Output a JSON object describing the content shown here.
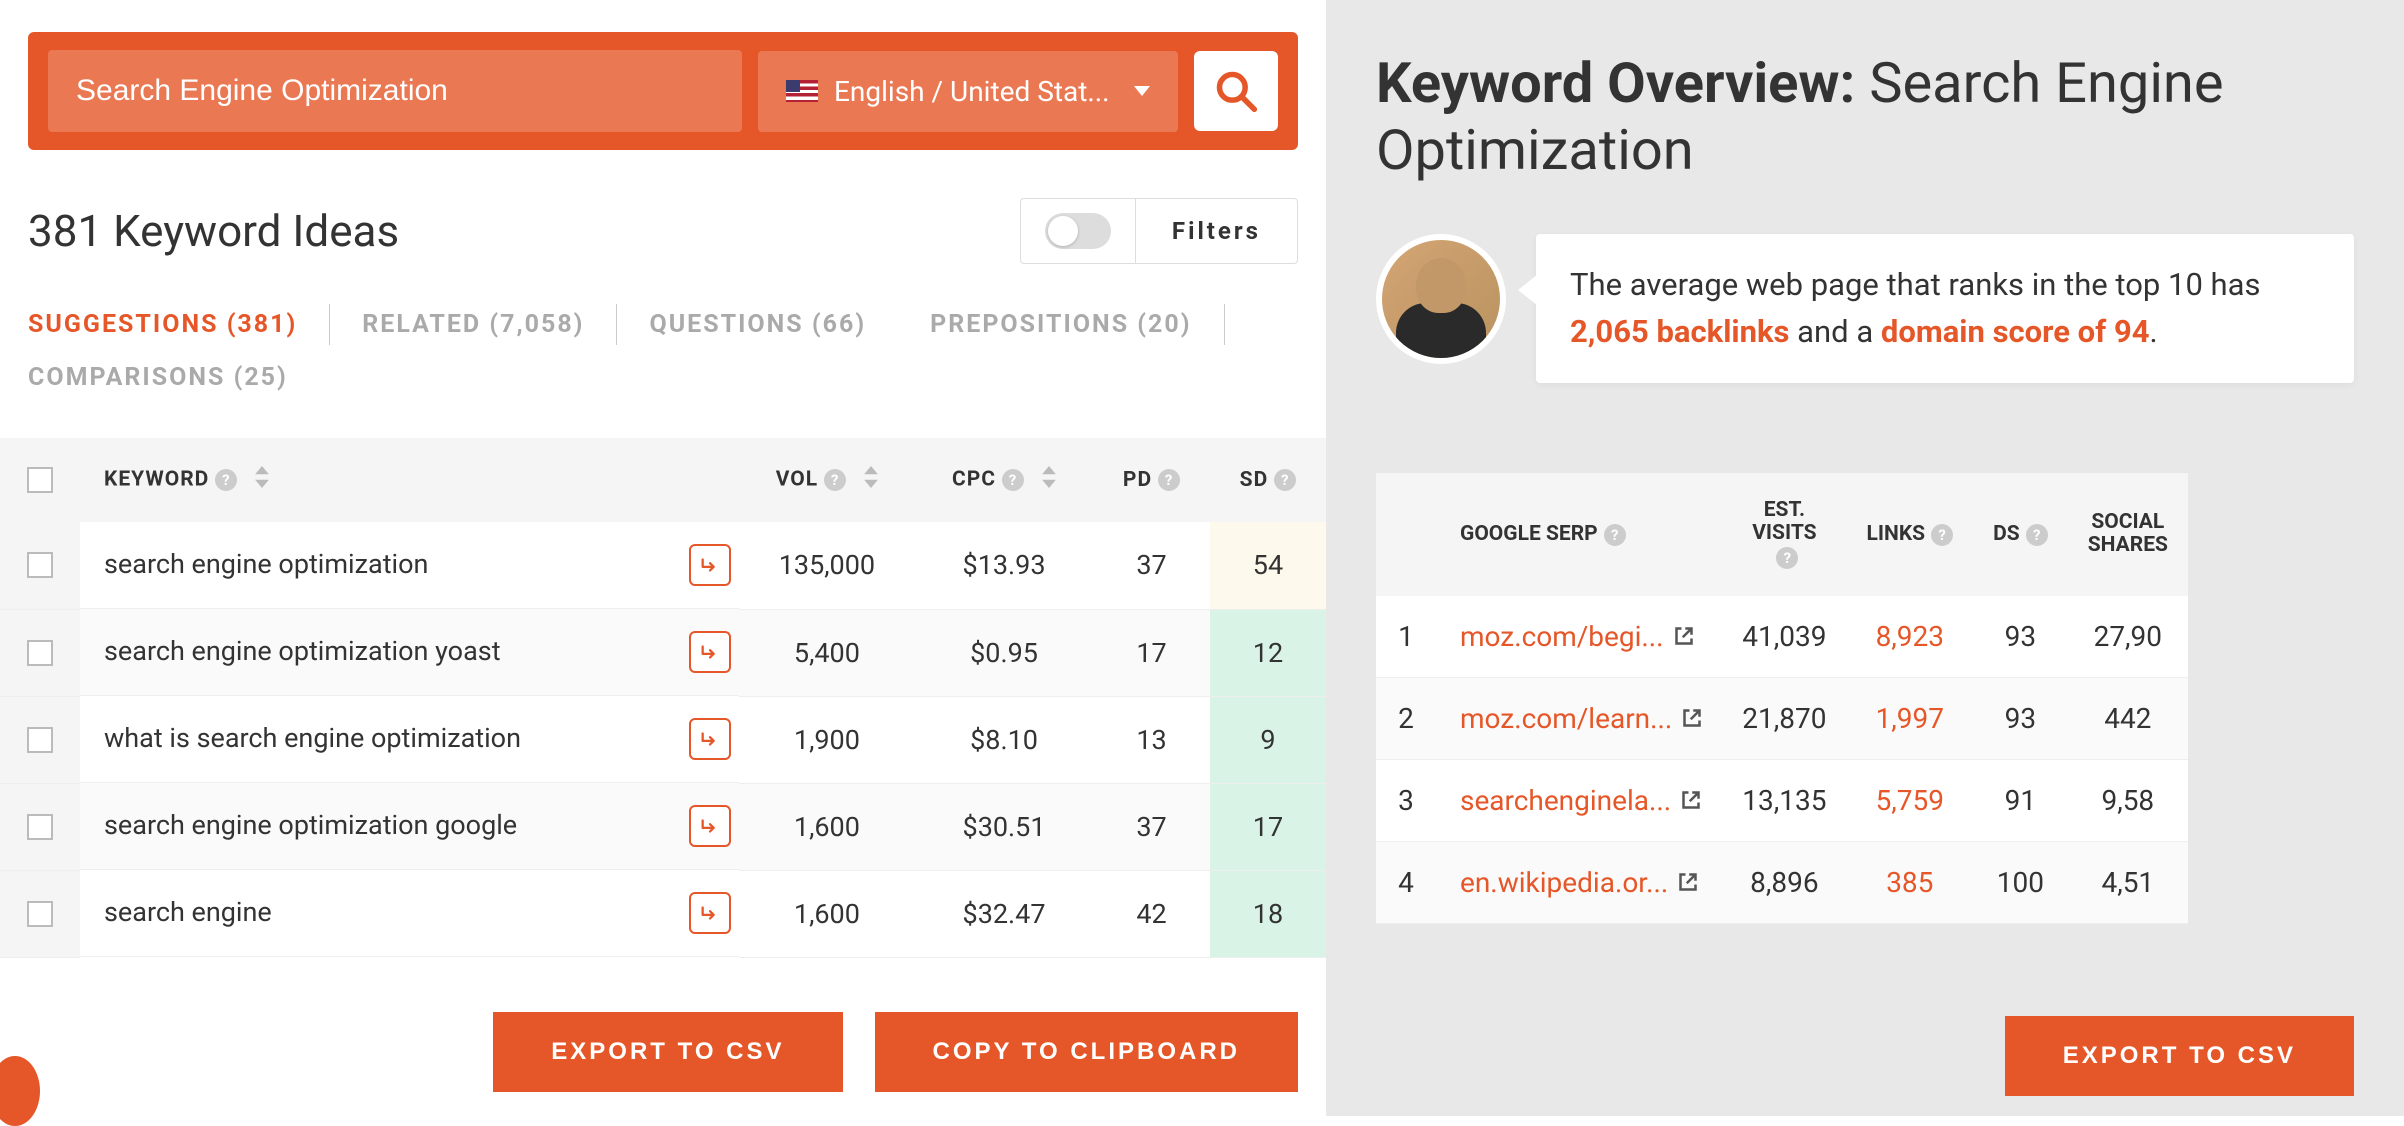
{
  "search": {
    "value": "Search Engine Optimization",
    "language": "English / United Stat...",
    "filters_label": "Filters"
  },
  "ideas": {
    "title": "381 Keyword Ideas",
    "tabs": [
      {
        "label": "SUGGESTIONS (381)",
        "active": true
      },
      {
        "label": "RELATED (7,058)",
        "active": false
      },
      {
        "label": "QUESTIONS (66)",
        "active": false
      },
      {
        "label": "PREPOSITIONS (20)",
        "active": false
      },
      {
        "label": "COMPARISONS (25)",
        "active": false
      }
    ],
    "headers": {
      "kw": "KEYWORD",
      "vol": "VOL",
      "cpc": "CPC",
      "pd": "PD",
      "sd": "SD"
    },
    "rows": [
      {
        "kw": "search engine optimization",
        "vol": "135,000",
        "cpc": "$13.93",
        "pd": "37",
        "sd": "54",
        "sd_class": "sd-cell-54"
      },
      {
        "kw": "search engine optimization yoast",
        "vol": "5,400",
        "cpc": "$0.95",
        "pd": "17",
        "sd": "12",
        "sd_class": "sd-cell-12"
      },
      {
        "kw": "what is search engine optimization",
        "vol": "1,900",
        "cpc": "$8.10",
        "pd": "13",
        "sd": "9",
        "sd_class": "sd-cell-9"
      },
      {
        "kw": "search engine optimization google",
        "vol": "1,600",
        "cpc": "$30.51",
        "pd": "37",
        "sd": "17",
        "sd_class": "sd-cell-17"
      },
      {
        "kw": "search engine",
        "vol": "1,600",
        "cpc": "$32.47",
        "pd": "42",
        "sd": "18",
        "sd_class": "sd-cell-18"
      }
    ],
    "export_label": "EXPORT TO CSV",
    "copy_label": "COPY TO CLIPBOARD"
  },
  "overview": {
    "title_bold": "Keyword Overview:",
    "title_rest": " Search Engine Optimization",
    "tip_pre": "The average web page that ranks in the top 10 has ",
    "tip_backlinks": "2,065 backlinks",
    "tip_mid": " and a ",
    "tip_domain": "domain score of 94",
    "tip_end": ".",
    "headers": {
      "serp": "GOOGLE SERP",
      "visits_l1": "EST.",
      "visits_l2": "VISITS",
      "links": "LINKS",
      "ds": "DS",
      "social_l1": "SOCIAL",
      "social_l2": "SHARES"
    },
    "rows": [
      {
        "rank": "1",
        "url": "moz.com/begi...",
        "visits": "41,039",
        "links": "8,923",
        "ds": "93",
        "social": "27,90"
      },
      {
        "rank": "2",
        "url": "moz.com/learn...",
        "visits": "21,870",
        "links": "1,997",
        "ds": "93",
        "social": "442"
      },
      {
        "rank": "3",
        "url": "searchenginela...",
        "visits": "13,135",
        "links": "5,759",
        "ds": "91",
        "social": "9,58"
      },
      {
        "rank": "4",
        "url": "en.wikipedia.or...",
        "visits": "8,896",
        "links": "385",
        "ds": "100",
        "social": "4,51"
      }
    ],
    "export_label": "EXPORT TO CSV"
  }
}
